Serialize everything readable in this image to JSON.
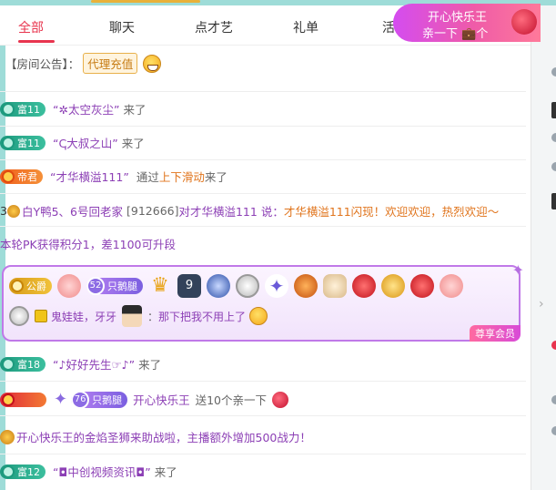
{
  "tabs": [
    {
      "label": "全部",
      "active": true
    },
    {
      "label": "聊天",
      "active": false
    },
    {
      "label": "点才艺",
      "active": false
    },
    {
      "label": "礼单",
      "active": false
    },
    {
      "label": "活",
      "active": false
    }
  ],
  "gift_banner": {
    "line1": "开心快乐王",
    "line2": "亲一下 💼个"
  },
  "notice": {
    "label": "【房间公告】：",
    "tag": "代理充值"
  },
  "messages": [
    {
      "level": "富11",
      "nick": "“✲太空灰尘”",
      "action": "来了"
    },
    {
      "level": "富11",
      "nick": "“ↅ大叔之山”",
      "action": "来了"
    },
    {
      "level": "帝君",
      "nick": "“才华横溢111”",
      "via": "通过",
      "via_hl": "上下滑动",
      "action": "来了"
    },
    {
      "prefix": "3",
      "text_a": "白Y鸭5、6号回老家",
      "id": "[912666]",
      "text_b": "对才华横溢111 说：",
      "quote": "才华横溢111闪现！欢迎欢迎，热烈欢迎～"
    },
    {
      "text": "本轮PK获得积分1，差1100可升段"
    },
    {
      "level": "富18",
      "nick": "“♪好好先生☞♪”",
      "action": "来了"
    },
    {
      "fan_level": "76",
      "fan_name": "只鹅腿",
      "nick": "开心快乐王",
      "action": "送10个亲一下"
    },
    {
      "text": "开心快乐王的金焰圣狮来助战啦，主播额外增加500战力！"
    },
    {
      "level": "富12",
      "nick": "“◘中创视频资讯◘”",
      "action": "来了"
    }
  ],
  "vip": {
    "rank": "公爵",
    "fan_level": "52",
    "fan_name": "只鹅腿",
    "badge_num": "9",
    "sender": "鬼娃娃，牙牙",
    "colon": "：",
    "text": "那下把我不用上了",
    "tag": "尊享会员"
  },
  "colors": {
    "accent": "#e8344e",
    "teal": "#1d9a7e",
    "purple": "#8c3fb5",
    "orange": "#e0741c",
    "frame": "#9edcd8"
  }
}
